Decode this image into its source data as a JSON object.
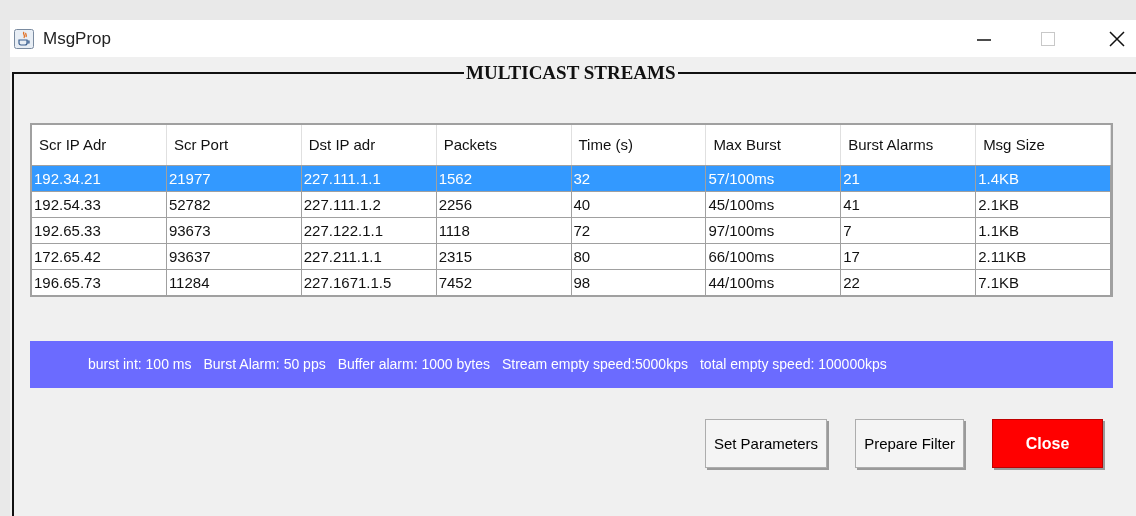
{
  "window": {
    "title": "MsgProp"
  },
  "panel": {
    "title": "MULTICAST STREAMS"
  },
  "table": {
    "columns": [
      "Scr IP Adr",
      "Scr Port",
      "Dst IP adr",
      "Packets",
      "Time (s)",
      "Max Burst",
      "Burst Alarms",
      "Msg Size"
    ],
    "rows": [
      {
        "selected": true,
        "cells": [
          "192.34.21",
          "21977",
          "227.111.1.1",
          "1562",
          "32",
          "57/100ms",
          "21",
          "1.4KB"
        ]
      },
      {
        "selected": false,
        "cells": [
          "192.54.33",
          "52782",
          "227.111.1.2",
          "2256",
          "40",
          "45/100ms",
          "41",
          "2.1KB"
        ]
      },
      {
        "selected": false,
        "cells": [
          "192.65.33",
          "93673",
          "227.122.1.1",
          "1118",
          "72",
          "97/100ms",
          "7",
          "1.1KB"
        ]
      },
      {
        "selected": false,
        "cells": [
          "172.65.42",
          "93637",
          "227.211.1.1",
          "2315",
          "80",
          "66/100ms",
          "17",
          "2.11KB"
        ]
      },
      {
        "selected": false,
        "cells": [
          "196.65.73",
          "11284",
          "227.1671.1.5",
          "7452",
          "98",
          "44/100ms",
          "22",
          "7.1KB"
        ]
      }
    ]
  },
  "status_bar": [
    "burst int: 100 ms",
    "Burst Alarm: 50 pps",
    "Buffer alarm: 1000 bytes",
    "Stream empty speed:5000kps",
    "total empty speed: 100000kps"
  ],
  "buttons": [
    {
      "label": "Set Parameters",
      "kind": "default"
    },
    {
      "label": "Prepare Filter",
      "kind": "default"
    },
    {
      "label": "Close",
      "kind": "danger"
    }
  ]
}
